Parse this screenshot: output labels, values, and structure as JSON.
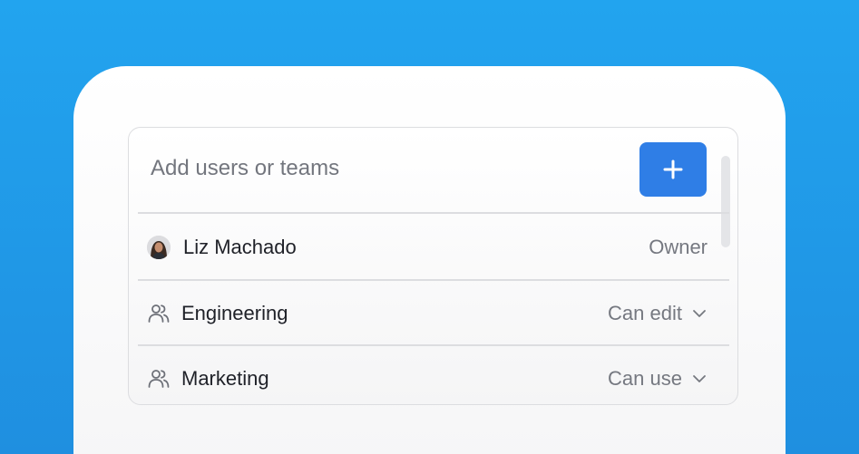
{
  "add": {
    "placeholder": "Add users or teams",
    "button_icon": "plus-icon",
    "button_color": "#2f7ee6"
  },
  "members": [
    {
      "name": "Liz Machado",
      "type": "user",
      "icon": "avatar",
      "role": "Owner",
      "editable": false
    },
    {
      "name": "Engineering",
      "type": "team",
      "icon": "team-icon",
      "role": "Can edit",
      "editable": true
    },
    {
      "name": "Marketing",
      "type": "team",
      "icon": "team-icon",
      "role": "Can use",
      "editable": true
    }
  ],
  "colors": {
    "background": "#22a4ef",
    "accent": "#2f7ee6"
  }
}
